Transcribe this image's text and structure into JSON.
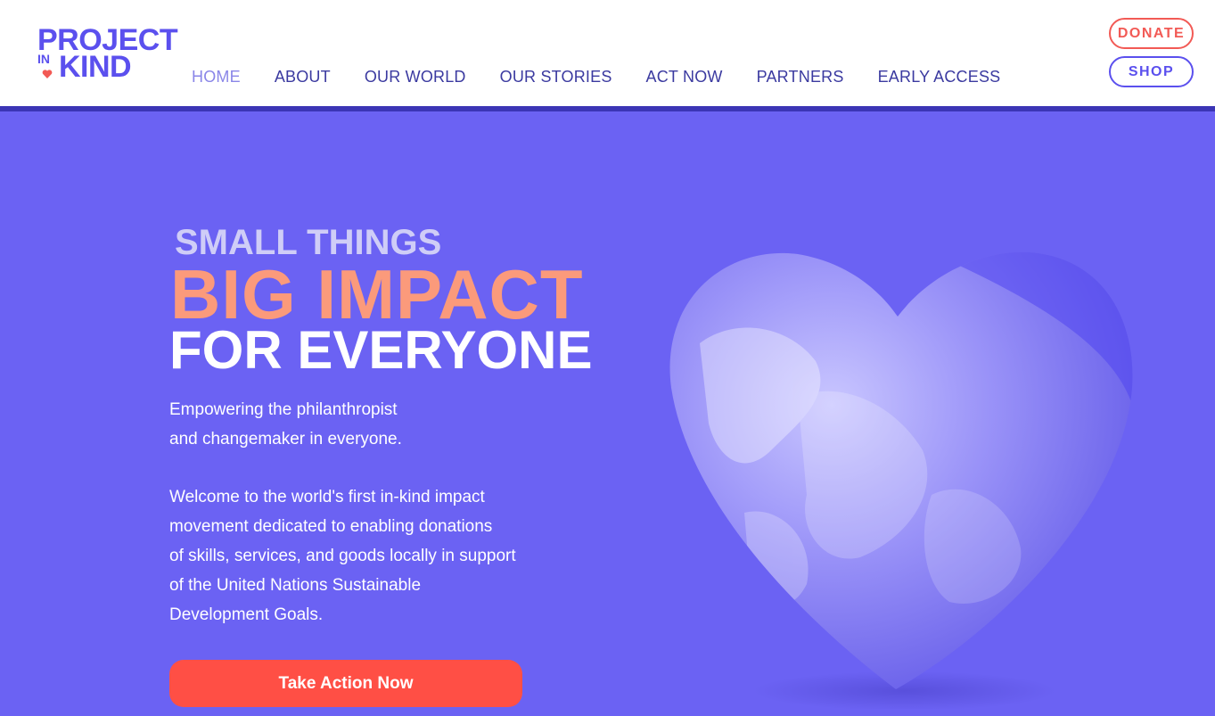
{
  "brand": {
    "logo_line1": "PROJECT",
    "logo_line2": "IN",
    "logo_line3": "KIND",
    "primary_color": "#5b50ee",
    "accent_color": "#f25a55",
    "hero_background": "#6b62f3"
  },
  "nav": {
    "items": [
      {
        "label": "HOME",
        "active": true
      },
      {
        "label": "ABOUT"
      },
      {
        "label": "OUR WORLD"
      },
      {
        "label": "OUR STORIES"
      },
      {
        "label": "ACT NOW"
      },
      {
        "label": "PARTNERS"
      },
      {
        "label": "EARLY ACCESS"
      }
    ]
  },
  "actions": {
    "donate_label": "DONATE",
    "shop_label": "SHOP"
  },
  "hero": {
    "line1": "SMALL THINGS",
    "line2": "BIG IMPACT",
    "line3": "FOR EVERYONE",
    "lead": [
      "Empowering the philanthropist",
      "and changemaker in everyone."
    ],
    "paragraph": [
      "Welcome to the world's first in-kind impact",
      "movement dedicated to enabling donations",
      "of skills, services, and goods locally in support",
      "of the United Nations Sustainable",
      "Development Goals."
    ],
    "cta_label": "Take Action Now",
    "image": "heart-shaped-earth"
  }
}
